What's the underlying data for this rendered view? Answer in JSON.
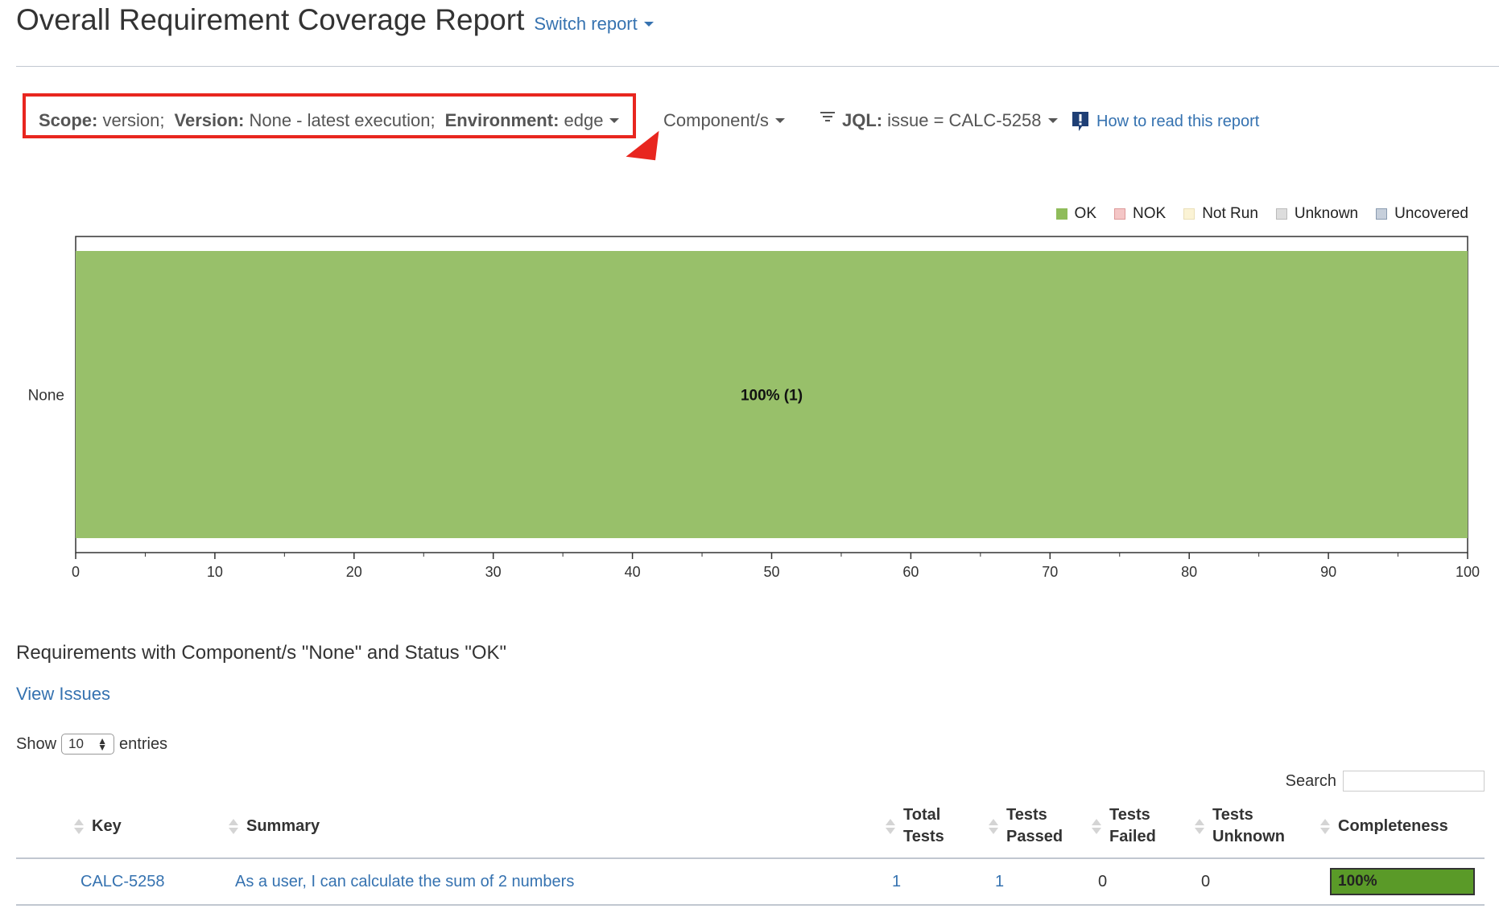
{
  "header": {
    "title": "Overall Requirement Coverage Report",
    "switch_report": "Switch report"
  },
  "filters": {
    "scope_label": "Scope:",
    "scope_value": "version;",
    "version_label": "Version:",
    "version_value": "None - latest execution;",
    "environment_label": "Environment:",
    "environment_value": "edge",
    "components": "Component/s",
    "jql_label": "JQL:",
    "jql_value": "issue = CALC-5258",
    "how_to_read": "How to read this report"
  },
  "legend": [
    {
      "label": "OK",
      "color": "#8fbc5a",
      "border": "#8fbc5a"
    },
    {
      "label": "NOK",
      "color": "#f4c6c6",
      "border": "#d99"
    },
    {
      "label": "Not Run",
      "color": "#fbf3d5",
      "border": "#eadfb8"
    },
    {
      "label": "Unknown",
      "color": "#dddddd",
      "border": "#bbbbbb"
    },
    {
      "label": "Uncovered",
      "color": "#c6cfdb",
      "border": "#8a9bb0"
    }
  ],
  "chart_data": {
    "type": "bar",
    "orientation": "horizontal",
    "stacked": true,
    "categories": [
      "None"
    ],
    "series": [
      {
        "name": "OK",
        "values": [
          100
        ],
        "labels": [
          "100% (1)"
        ],
        "color": "#98c06a"
      }
    ],
    "xlim": [
      0,
      100
    ],
    "xticks": [
      0,
      10,
      20,
      30,
      40,
      50,
      60,
      70,
      80,
      90,
      100
    ],
    "legend_position": "top-right"
  },
  "requirements": {
    "title": "Requirements with Component/s \"None\" and Status \"OK\"",
    "view_issues": "View Issues",
    "show_label": "Show",
    "page_size": "10",
    "entries_label": "entries",
    "search_label": "Search",
    "columns": [
      {
        "key": "key",
        "line1": "Key",
        "line2": ""
      },
      {
        "key": "summary",
        "line1": "Summary",
        "line2": ""
      },
      {
        "key": "total",
        "line1": "Total",
        "line2": "Tests"
      },
      {
        "key": "passed",
        "line1": "Tests",
        "line2": "Passed"
      },
      {
        "key": "failed",
        "line1": "Tests",
        "line2": "Failed"
      },
      {
        "key": "unknown",
        "line1": "Tests",
        "line2": "Unknown"
      },
      {
        "key": "completeness",
        "line1": "Completeness",
        "line2": ""
      }
    ],
    "rows": [
      {
        "key": "CALC-5258",
        "summary": "As a user, I can calculate the sum of 2 numbers",
        "total": "1",
        "passed": "1",
        "failed": "0",
        "unknown": "0",
        "completeness": "100%",
        "completeness_fraction": 1.0
      }
    ]
  }
}
